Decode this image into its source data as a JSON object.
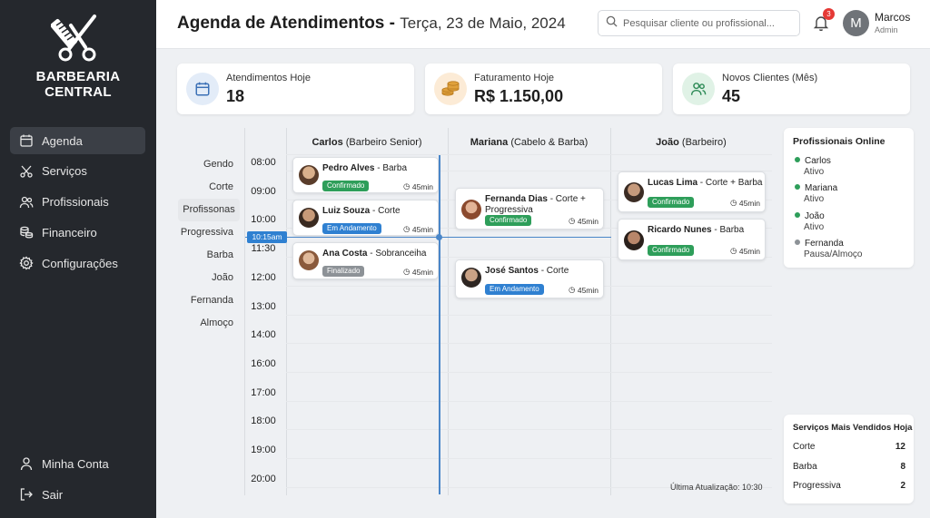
{
  "sidebar": {
    "brand_line1": "BARBEARIA",
    "brand_line2": "CENTRAL",
    "nav": [
      "Agenda",
      "Serviços",
      "Profissionais",
      "Financeiro",
      "Configurações"
    ],
    "bottom": [
      "Minha Conta",
      "Sair"
    ]
  },
  "header": {
    "title": "Agenda de Atendimentos",
    "separator": " - ",
    "date": "Terça, 23 de Maio, 2024",
    "search_placeholder": "Pesquisar cliente ou profissional...",
    "notifications": "3",
    "user_initial": "M",
    "user_name": "Marcos",
    "user_role": "Admin"
  },
  "stats": [
    {
      "label": "Atendimentos Hoje",
      "value": "18"
    },
    {
      "label": "Faturamento Hoje",
      "value": "R$ 1.150,00"
    },
    {
      "label": "Novos Clientes (Mês)",
      "value": "45"
    }
  ],
  "filters": [
    "Gendo",
    "Corte",
    "Profissonas",
    "Progressiva",
    "Barba",
    "João",
    "Fernanda",
    "Almoço"
  ],
  "columns": [
    {
      "name": "Carlos",
      "role": " (Barbeiro Senior)"
    },
    {
      "name": "Mariana",
      "role": " (Cabelo & Barba)"
    },
    {
      "name": "João",
      "role": " (Barbeiro)"
    }
  ],
  "times": [
    "08:00",
    "09:00",
    "10:00",
    "11:30",
    "12:00",
    "13:00",
    "14:00",
    "16:00",
    "17:00",
    "18:00",
    "19:00",
    "20:00"
  ],
  "now_label": "10:15am",
  "appointments": {
    "carlos": [
      {
        "client": "Pedro Alves",
        "service": " - Barba",
        "status": "Confirmado",
        "duration": "45min"
      },
      {
        "client": "Luiz Souza",
        "service": " - Corte",
        "status": "Em Andamento",
        "duration": "45min"
      },
      {
        "client": "Ana Costa",
        "service": " - Sobranceiha",
        "status": "Finalizado",
        "duration": "45min"
      }
    ],
    "mariana": [
      {
        "client": "Fernanda Dias",
        "service": " - Corte +",
        "service2": "Progressiva",
        "status": "Confirmado",
        "duration": "45min"
      },
      {
        "client": "José Santos",
        "service": " - Corte",
        "status": "Em Andamento",
        "duration": "45min"
      }
    ],
    "joao": [
      {
        "client": "Lucas Lima",
        "service": " - Corte + Barba",
        "status": "Confirmado",
        "duration": "45min"
      },
      {
        "client": "Ricardo Nunes",
        "service": " - Barba",
        "status": "Confirmado",
        "duration": "45min"
      }
    ]
  },
  "last_update": "Última Atualização: 10:30",
  "online": {
    "title": "Profissionais Online",
    "people": [
      {
        "name": "Carlos",
        "status": "Ativo"
      },
      {
        "name": "Mariana",
        "status": "Ativo"
      },
      {
        "name": "João",
        "status": "Ativo"
      },
      {
        "name": "Fernanda",
        "status": "Pausa/Almoço"
      }
    ]
  },
  "top_services": {
    "title": "Serviços Mais Vendidos Hoja",
    "items": [
      {
        "name": "Corte",
        "count": "12"
      },
      {
        "name": "Barba",
        "count": "8"
      },
      {
        "name": "Progressiva",
        "count": "2"
      }
    ]
  },
  "colors": {
    "sidebar": "#25282d",
    "confirmed": "#2e9e5a",
    "in_progress": "#2f80d1",
    "done": "#8d9297",
    "online": "#2e9e5a",
    "paused": "#8d9297"
  }
}
